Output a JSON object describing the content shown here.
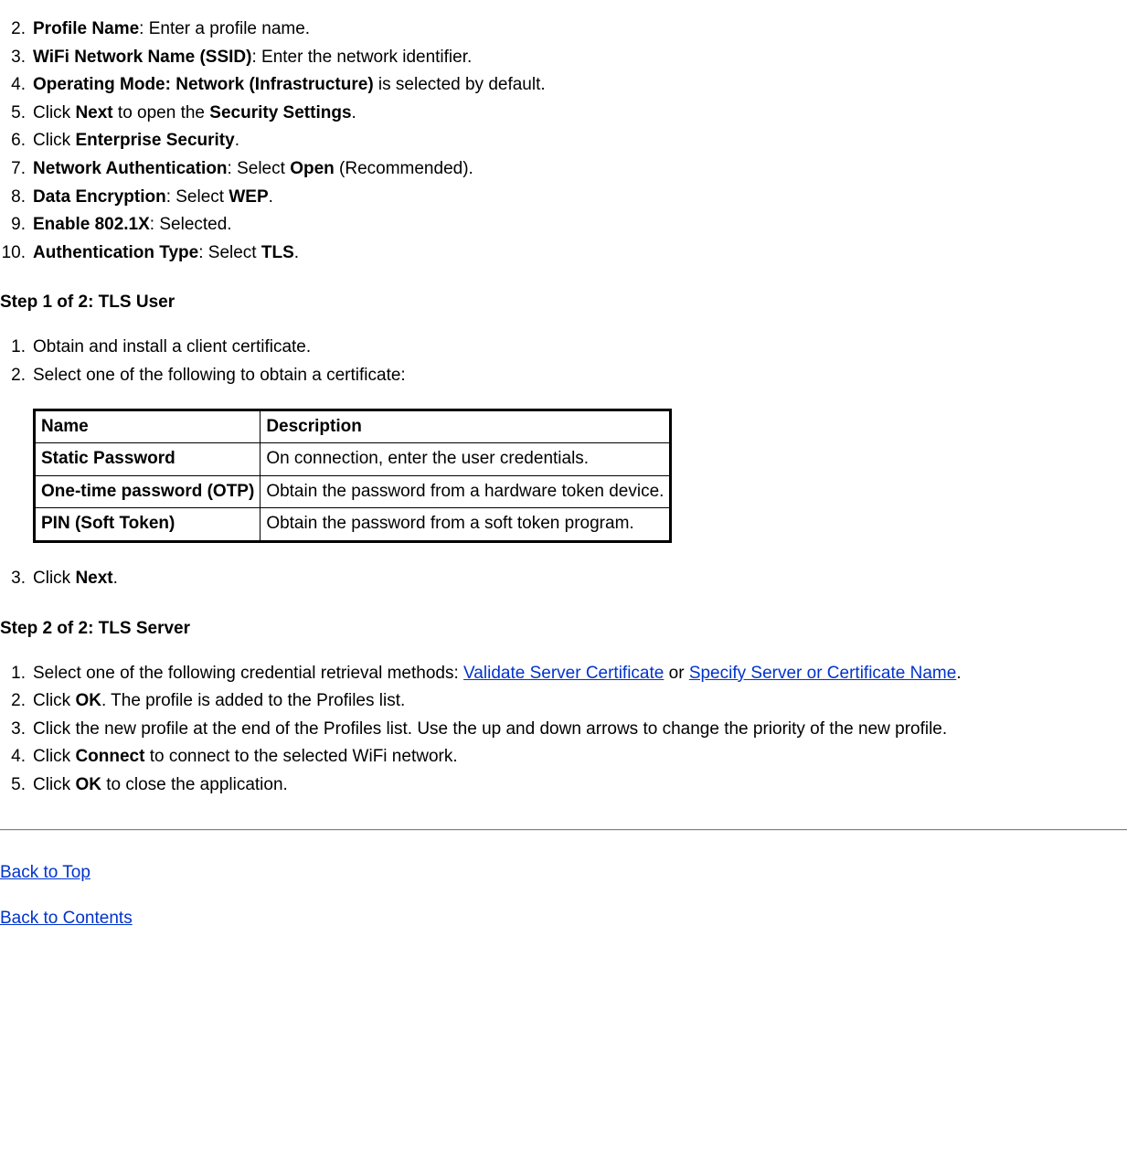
{
  "listA": {
    "items": [
      {
        "num": "2.",
        "bold": "Profile Name",
        "after": ": Enter a profile name."
      },
      {
        "num": "3.",
        "bold": "WiFi Network Name (SSID)",
        "after": ": Enter the network identifier."
      },
      {
        "num": "4.",
        "bold": "Operating Mode: Network (Infrastructure)",
        "after": " is selected by default."
      },
      {
        "num": "5.",
        "pre": "Click ",
        "bold": "Next",
        "after": " to open the ",
        "bold2": "Security Settings",
        "after2": "."
      },
      {
        "num": "6.",
        "pre": "Click ",
        "bold": "Enterprise Security",
        "after": "."
      },
      {
        "num": "7.",
        "bold": "Network Authentication",
        "after": ": Select ",
        "bold2": "Open",
        "after2": " (Recommended)."
      },
      {
        "num": "8.",
        "bold": "Data Encryption",
        "after": ": Select ",
        "bold2": "WEP",
        "after2": "."
      },
      {
        "num": "9.",
        "bold": "Enable 802.1X",
        "after": ": Selected."
      },
      {
        "num": "10.",
        "bold": "Authentication Type",
        "after": ": Select ",
        "bold2": "TLS",
        "after2": "."
      }
    ]
  },
  "step1": {
    "heading": "Step 1 of 2: TLS User",
    "items": [
      {
        "num": "1.",
        "text": "Obtain and install a client certificate."
      },
      {
        "num": "2.",
        "text": "Select one of the following to obtain a certificate:"
      }
    ],
    "table": {
      "headers": {
        "c1": "Name",
        "c2": "Description"
      },
      "rows": [
        {
          "c1": "Static Password",
          "c2": "On connection, enter the user credentials."
        },
        {
          "c1": "One-time password (OTP)",
          "c2": "Obtain the password from a hardware token device."
        },
        {
          "c1": "PIN (Soft Token)",
          "c2": "Obtain the password from a soft token program."
        }
      ]
    },
    "item3": {
      "num": "3.",
      "pre": "Click ",
      "bold": "Next",
      "after": "."
    }
  },
  "step2": {
    "heading": "Step 2 of 2: TLS Server",
    "items": {
      "i1": {
        "num": "1.",
        "pre": "Select one of the following credential retrieval methods: ",
        "link1": "Validate Server Certificate",
        "mid": " or ",
        "link2": "Specify Server or Certificate Name",
        "after": "."
      },
      "i2": {
        "num": "2.",
        "pre": "Click ",
        "bold": "OK",
        "after": ". The profile is added to the Profiles list."
      },
      "i3": {
        "num": "3.",
        "text": "Click the new profile at the end of the Profiles list. Use the up and down arrows to change the priority of the new profile."
      },
      "i4": {
        "num": "4.",
        "pre": "Click ",
        "bold": "Connect",
        "after": " to connect to the selected WiFi network."
      },
      "i5": {
        "num": "5.",
        "pre": "Click ",
        "bold": "OK",
        "after": " to close the application."
      }
    }
  },
  "footer": {
    "back_top": "Back to Top",
    "back_contents": "Back to Contents"
  }
}
